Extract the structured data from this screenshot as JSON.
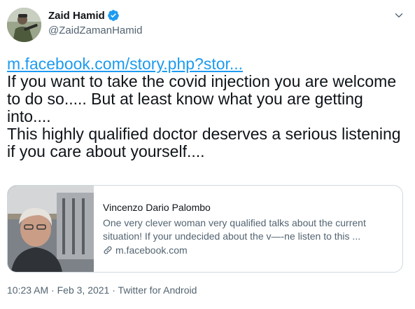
{
  "author": {
    "display_name": "Zaid Hamid",
    "handle": "@ZaidZamanHamid",
    "verified": true,
    "avatar_icon": "profile-photo"
  },
  "tweet": {
    "link_text": "m.facebook.com/story.php?stor...",
    "lines": [
      "If you want to take the covid injection you are welcome",
      "to do so..... But at least know what you are getting",
      "into....",
      "This highly qualified doctor deserves a serious listening",
      "if you care about yourself...."
    ]
  },
  "card": {
    "title": "Vincenzo Dario Palombo",
    "description_lines": [
      "One very clever woman very qualified talks about the current",
      "situation! If your undecided about the v—-ne listen to this ..."
    ],
    "domain": "m.facebook.com",
    "domain_icon": "link-icon"
  },
  "meta": {
    "time": "10:23 AM",
    "date": "Feb 3, 2021",
    "source": "Twitter for Android",
    "separator": "·"
  },
  "colors": {
    "link": "#1d9bf0",
    "text": "#0f1419",
    "secondary": "#536471",
    "border": "#cfd9de"
  }
}
